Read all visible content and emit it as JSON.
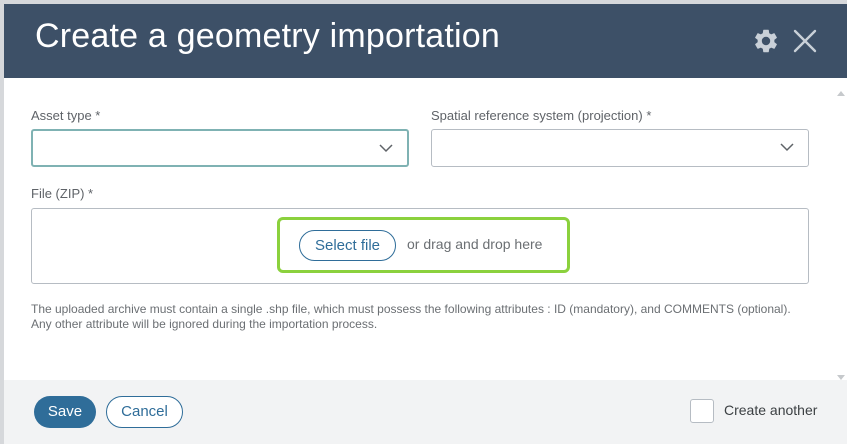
{
  "header": {
    "title": "Create a geometry importation",
    "settings_icon": "gear-icon",
    "close_icon": "close-icon"
  },
  "form": {
    "asset_type": {
      "label": "Asset type *",
      "value": ""
    },
    "spatial_reference": {
      "label": "Spatial reference system (projection) *",
      "value": ""
    },
    "file": {
      "label": "File (ZIP) *",
      "select_button": "Select file",
      "drag_text": "or drag and drop here"
    },
    "help_text": "The uploaded archive must contain a single .shp file, which must possess the following attributes : ID (mandatory), and COMMENTS (optional). Any other attribute will be ignored during the importation process."
  },
  "footer": {
    "save_label": "Save",
    "cancel_label": "Cancel",
    "create_another_label": "Create another",
    "create_another_checked": false
  },
  "colors": {
    "header_bg": "#3d5067",
    "primary": "#2f6d99",
    "highlight": "#8bd13d",
    "focus_border": "#7fb2b3"
  }
}
